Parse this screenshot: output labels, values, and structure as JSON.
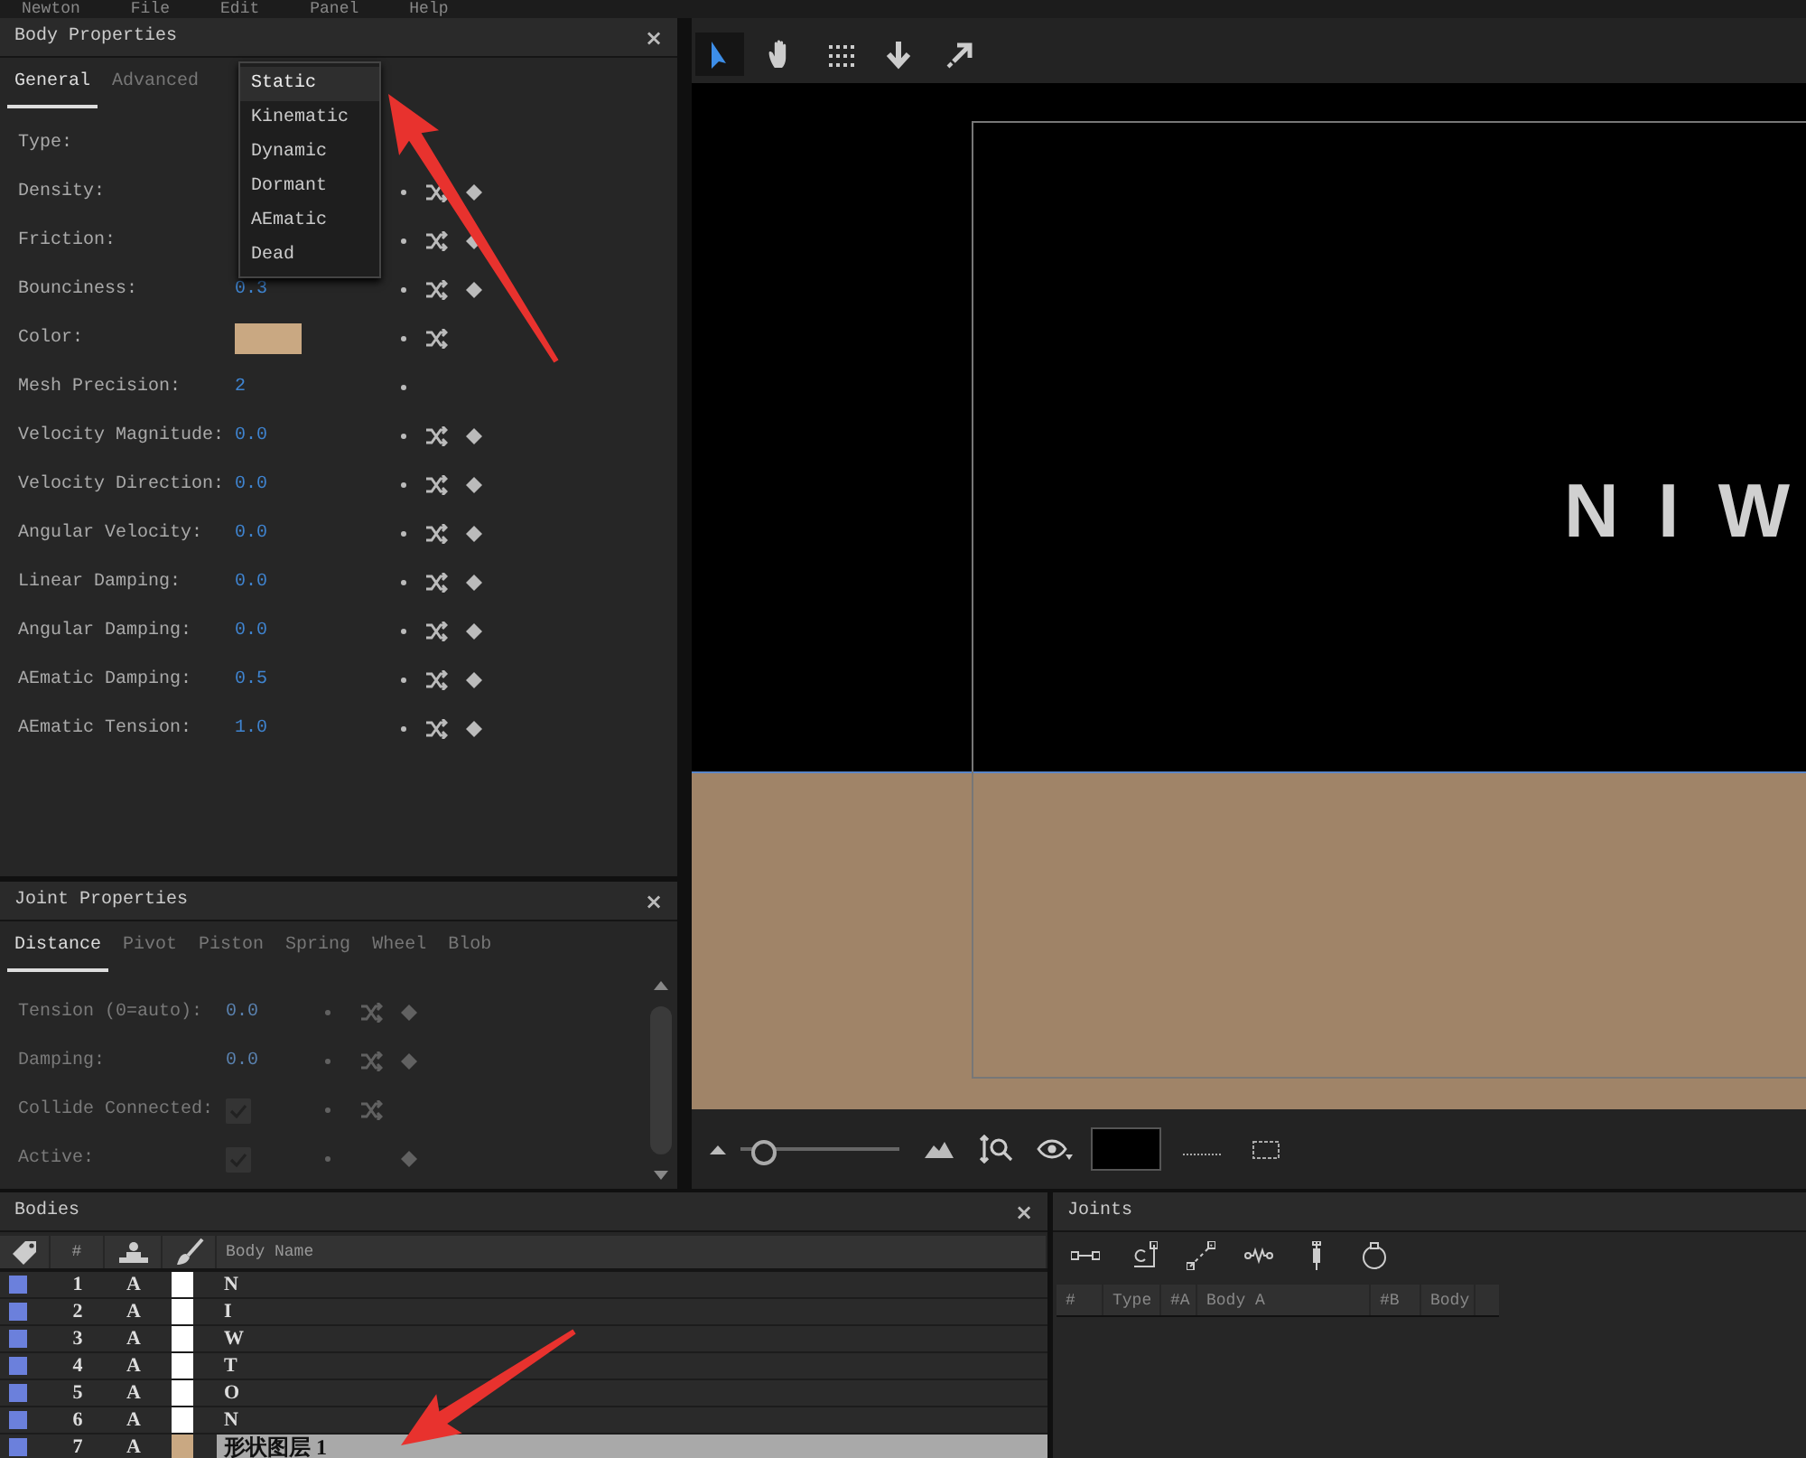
{
  "menu_bar": {
    "items": [
      "Newton",
      "File",
      "Edit",
      "Panel",
      "Help"
    ]
  },
  "body_properties": {
    "title": "Body Properties",
    "close": "×",
    "tabs": [
      {
        "label": "General",
        "selected": true
      },
      {
        "label": "Advanced",
        "selected": false
      }
    ],
    "rows": [
      {
        "kind": "dropdown",
        "label": "Type:",
        "dot": false,
        "randomize": false,
        "keyframe": false
      },
      {
        "kind": "number",
        "label": "Density:",
        "dot": true,
        "randomize": true,
        "keyframe": true
      },
      {
        "kind": "number",
        "label": "Friction:",
        "dot": true,
        "randomize": true,
        "keyframe": true
      },
      {
        "kind": "number",
        "label": "Bounciness:",
        "value": "0.3",
        "dot": true,
        "randomize": true,
        "keyframe": true
      },
      {
        "kind": "color",
        "label": "Color:",
        "color": "#c9a882",
        "dot": true,
        "randomize": true,
        "keyframe": false
      },
      {
        "kind": "number",
        "label": "Mesh Precision:",
        "value": "2",
        "dot": true,
        "randomize": false,
        "keyframe": false
      },
      {
        "kind": "number",
        "label": "Velocity Magnitude:",
        "value": "0.0",
        "dot": true,
        "randomize": true,
        "keyframe": true
      },
      {
        "kind": "number",
        "label": "Velocity Direction:",
        "value": "0.0",
        "dot": true,
        "randomize": true,
        "keyframe": true
      },
      {
        "kind": "number",
        "label": "Angular Velocity:",
        "value": "0.0",
        "dot": true,
        "randomize": true,
        "keyframe": true
      },
      {
        "kind": "number",
        "label": "Linear Damping:",
        "value": "0.0",
        "dot": true,
        "randomize": true,
        "keyframe": true
      },
      {
        "kind": "number",
        "label": "Angular Damping:",
        "value": "0.0",
        "dot": true,
        "randomize": true,
        "keyframe": true
      },
      {
        "kind": "number",
        "label": "AEmatic Damping:",
        "value": "0.5",
        "dot": true,
        "randomize": true,
        "keyframe": true
      },
      {
        "kind": "number",
        "label": "AEmatic Tension:",
        "value": "1.0",
        "dot": true,
        "randomize": true,
        "keyframe": true
      }
    ],
    "type_menu": {
      "options": [
        {
          "label": "Static",
          "selected": true
        },
        {
          "label": "Kinematic",
          "selected": false
        },
        {
          "label": "Dynamic",
          "selected": false
        },
        {
          "label": "Dormant",
          "selected": false
        },
        {
          "label": "AEmatic",
          "selected": false
        },
        {
          "label": "Dead",
          "selected": false
        }
      ]
    }
  },
  "joint_properties": {
    "title": "Joint Properties",
    "close": "×",
    "tabs": [
      {
        "label": "Distance",
        "selected": true
      },
      {
        "label": "Pivot",
        "selected": false
      },
      {
        "label": "Piston",
        "selected": false
      },
      {
        "label": "Spring",
        "selected": false
      },
      {
        "label": "Wheel",
        "selected": false
      },
      {
        "label": "Blob",
        "selected": false
      }
    ],
    "rows": [
      {
        "kind": "number",
        "label": "Tension (0=auto):",
        "value": "0.0",
        "disabled": true,
        "randomize": true,
        "keyframe": true
      },
      {
        "kind": "number",
        "label": "Damping:",
        "value": "0.0",
        "disabled": true,
        "randomize": true,
        "keyframe": true
      },
      {
        "kind": "checkbox",
        "label": "Collide Connected:",
        "checked": true,
        "disabled": true,
        "randomize": true,
        "keyframe": false
      },
      {
        "kind": "checkbox",
        "label": "Active:",
        "checked": true,
        "disabled": true,
        "randomize": false,
        "keyframe": true
      }
    ]
  },
  "viewport": {
    "tools": [
      {
        "kind": "select",
        "selected": true
      },
      {
        "kind": "hand",
        "selected": false
      },
      {
        "kind": "grid",
        "selected": false
      },
      {
        "kind": "down",
        "selected": false
      },
      {
        "kind": "expand",
        "selected": false
      }
    ],
    "canvas": {
      "text": "N I W"
    },
    "zoom": {
      "level": 0.12
    }
  },
  "bodies": {
    "title": "Bodies",
    "close": "×",
    "columns": [
      {
        "kind": "tag"
      },
      {
        "kind": "text",
        "label": "#"
      },
      {
        "kind": "solo"
      },
      {
        "kind": "brush"
      },
      {
        "kind": "text",
        "label": "Body Name"
      }
    ],
    "rows": [
      {
        "number": "1",
        "mode": "A",
        "color": "#ffffff",
        "name": "N",
        "selected": false
      },
      {
        "number": "2",
        "mode": "A",
        "color": "#ffffff",
        "name": "I",
        "selected": false
      },
      {
        "number": "3",
        "mode": "A",
        "color": "#ffffff",
        "name": "W",
        "selected": false
      },
      {
        "number": "4",
        "mode": "A",
        "color": "#ffffff",
        "name": "T",
        "selected": false
      },
      {
        "number": "5",
        "mode": "A",
        "color": "#ffffff",
        "name": "O",
        "selected": false
      },
      {
        "number": "6",
        "mode": "A",
        "color": "#ffffff",
        "name": "N",
        "selected": false
      },
      {
        "number": "7",
        "mode": "A",
        "color": "#c9a882",
        "name": "形状图层 1",
        "selected": true
      }
    ]
  },
  "joints": {
    "title": "Joints",
    "tools": [
      {
        "kind": "distance"
      },
      {
        "kind": "pivot"
      },
      {
        "kind": "piston"
      },
      {
        "kind": "spring"
      },
      {
        "kind": "wheel"
      },
      {
        "kind": "blob"
      }
    ],
    "columns": [
      "#",
      "Type",
      "#A",
      "Body A",
      "#B",
      "Body"
    ]
  }
}
